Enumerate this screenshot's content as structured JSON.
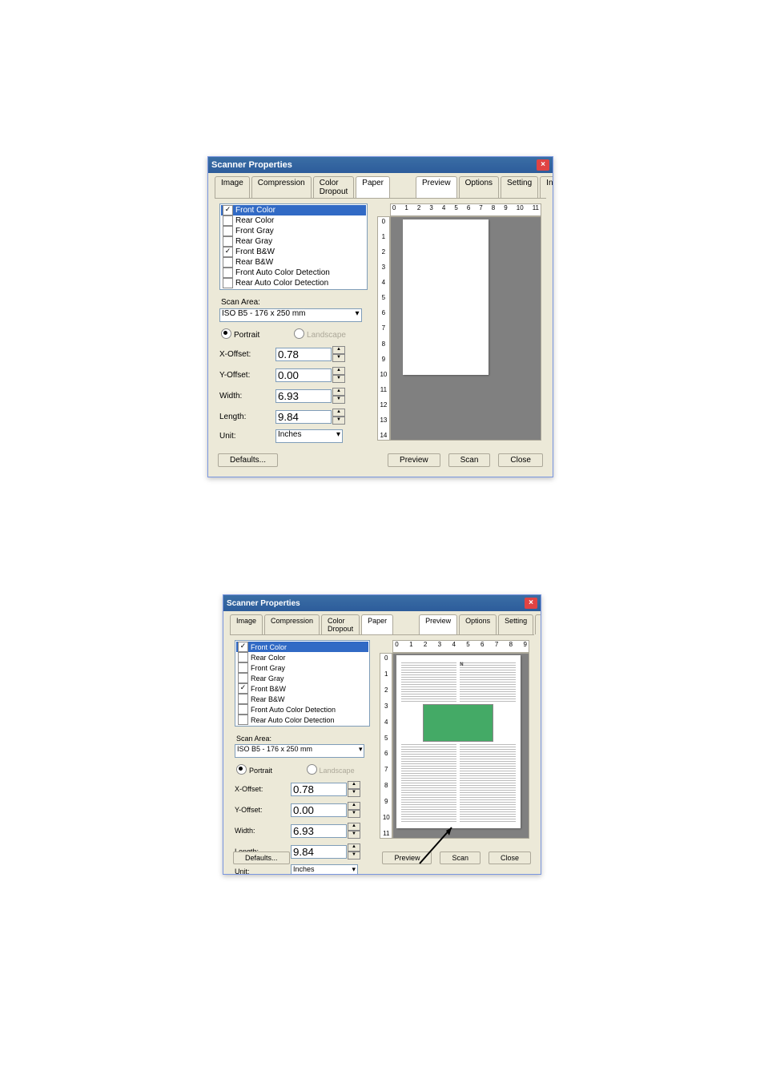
{
  "window_title": "Scanner Properties",
  "tabs_left": [
    "Image",
    "Compression",
    "Color Dropout",
    "Paper"
  ],
  "tabs_right": [
    "Preview",
    "Options",
    "Setting",
    "Information"
  ],
  "fig1": {
    "active_left_tab": 3,
    "active_right_tab": 0,
    "image_list": [
      {
        "label": "Front Color",
        "checked": true,
        "selected": true
      },
      {
        "label": "Rear Color",
        "checked": false,
        "selected": false
      },
      {
        "label": "Front Gray",
        "checked": false,
        "selected": false
      },
      {
        "label": "Rear Gray",
        "checked": false,
        "selected": false
      },
      {
        "label": "Front B&W",
        "checked": true,
        "selected": false
      },
      {
        "label": "Rear B&W",
        "checked": false,
        "selected": false
      },
      {
        "label": "Front Auto Color Detection",
        "checked": false,
        "selected": false
      },
      {
        "label": "Rear Auto Color Detection",
        "checked": false,
        "selected": false
      }
    ],
    "scan_area_label": "Scan Area:",
    "scan_area_value": "ISO B5 - 176 x 250 mm",
    "orientation": {
      "portrait": "Portrait",
      "landscape": "Landscape",
      "selected": "portrait"
    },
    "fields": {
      "xoffset": {
        "label": "X-Offset:",
        "value": "0.78"
      },
      "yoffset": {
        "label": "Y-Offset:",
        "value": "0.00"
      },
      "width": {
        "label": "Width:",
        "value": "6.93"
      },
      "length": {
        "label": "Length:",
        "value": "9.84"
      },
      "unit": {
        "label": "Unit:",
        "value": "Inches"
      }
    },
    "ruler_h": [
      "0",
      "1",
      "2",
      "3",
      "4",
      "5",
      "6",
      "7",
      "8",
      "9",
      "10",
      "11"
    ],
    "ruler_v": [
      "0",
      "1",
      "2",
      "3",
      "4",
      "5",
      "6",
      "7",
      "8",
      "9",
      "10",
      "11",
      "12",
      "13",
      "14"
    ]
  },
  "fig2": {
    "active_left_tab": 3,
    "active_right_tab": 0,
    "image_list": [
      {
        "label": "Front Color",
        "checked": true,
        "selected": true
      },
      {
        "label": "Rear Color",
        "checked": false,
        "selected": false
      },
      {
        "label": "Front Gray",
        "checked": false,
        "selected": false
      },
      {
        "label": "Rear Gray",
        "checked": false,
        "selected": false
      },
      {
        "label": "Front B&W",
        "checked": true,
        "selected": false
      },
      {
        "label": "Rear B&W",
        "checked": false,
        "selected": false
      },
      {
        "label": "Front Auto Color Detection",
        "checked": false,
        "selected": false
      },
      {
        "label": "Rear Auto Color Detection",
        "checked": false,
        "selected": false
      }
    ],
    "scan_area_label": "Scan Area:",
    "scan_area_value": "ISO B5 - 176 x 250 mm",
    "orientation": {
      "portrait": "Portrait",
      "landscape": "Landscape",
      "selected": "portrait"
    },
    "fields": {
      "xoffset": {
        "label": "X-Offset:",
        "value": "0.78"
      },
      "yoffset": {
        "label": "Y-Offset:",
        "value": "0.00"
      },
      "width": {
        "label": "Width:",
        "value": "6.93"
      },
      "length": {
        "label": "Length:",
        "value": "9.84"
      },
      "unit": {
        "label": "Unit:",
        "value": "Inches"
      }
    },
    "ruler_h": [
      "0",
      "1",
      "2",
      "3",
      "4",
      "5",
      "6",
      "7",
      "8",
      "9"
    ],
    "ruler_v": [
      "0",
      "1",
      "2",
      "3",
      "4",
      "5",
      "6",
      "7",
      "8",
      "9",
      "10",
      "11"
    ]
  },
  "buttons": {
    "defaults": "Defaults...",
    "preview": "Preview",
    "scan": "Scan",
    "close": "Close"
  }
}
